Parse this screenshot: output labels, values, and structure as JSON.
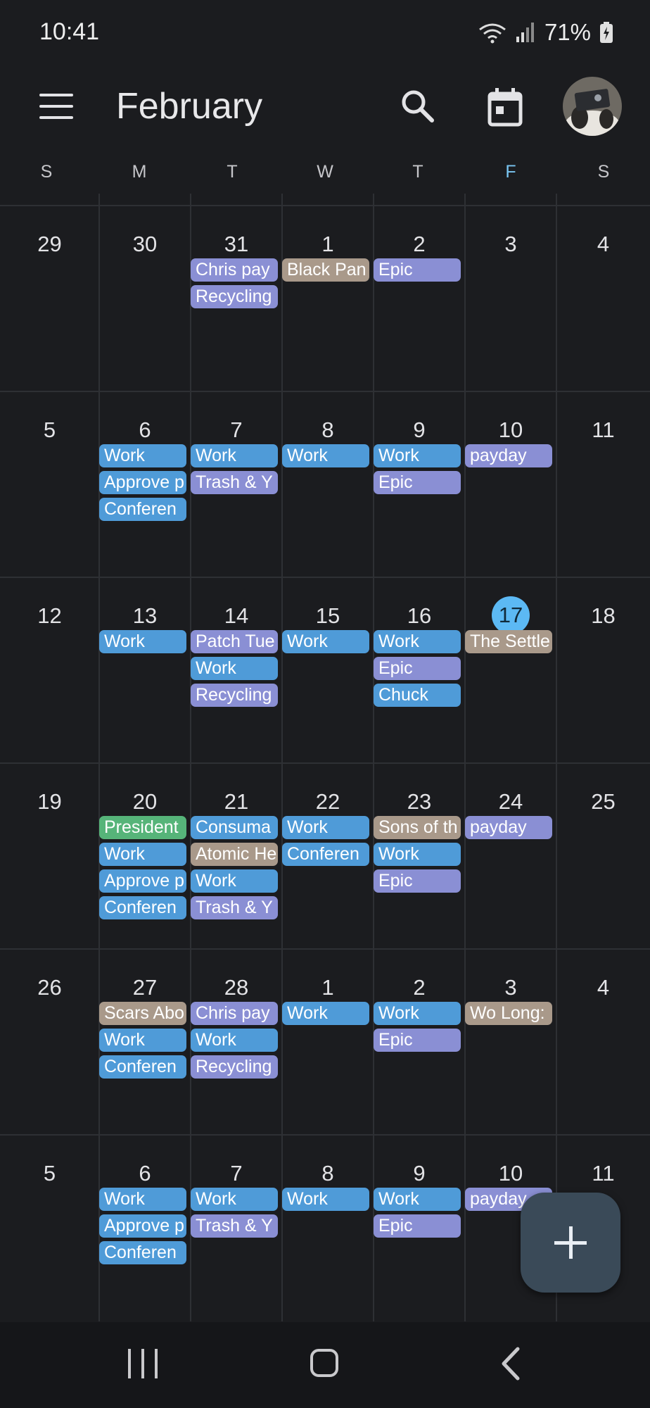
{
  "status": {
    "time": "10:41",
    "battery": "71%"
  },
  "header": {
    "title": "February"
  },
  "days_of_week": [
    {
      "label": "S",
      "hl": false
    },
    {
      "label": "M",
      "hl": false
    },
    {
      "label": "T",
      "hl": false
    },
    {
      "label": "W",
      "hl": false
    },
    {
      "label": "T",
      "hl": false
    },
    {
      "label": "F",
      "hl": true
    },
    {
      "label": "S",
      "hl": false
    }
  ],
  "colors": {
    "work_blue": "#4f9bd8",
    "task_purple": "#8a8fd4",
    "release_tan": "#a9998a",
    "holiday_green": "#56b479",
    "today": "#5cb9f4"
  },
  "weeks": [
    {
      "days": [
        {
          "num": "29",
          "events": []
        },
        {
          "num": "30",
          "events": []
        },
        {
          "num": "31",
          "events": [
            {
              "t": "Chris pay",
              "c": "purple"
            },
            {
              "t": "Recycling",
              "c": "purple"
            }
          ]
        },
        {
          "num": "1",
          "events": [
            {
              "t": "Black Pan",
              "c": "tan"
            }
          ]
        },
        {
          "num": "2",
          "events": [
            {
              "t": "Epic",
              "c": "purple"
            }
          ]
        },
        {
          "num": "3",
          "events": []
        },
        {
          "num": "4",
          "events": []
        }
      ]
    },
    {
      "days": [
        {
          "num": "5",
          "events": []
        },
        {
          "num": "6",
          "events": [
            {
              "t": "Work",
              "c": "blue"
            },
            {
              "t": "Approve p",
              "c": "blue"
            },
            {
              "t": "Conferen",
              "c": "blue"
            }
          ]
        },
        {
          "num": "7",
          "events": [
            {
              "t": "Work",
              "c": "blue"
            },
            {
              "t": "Trash & Y",
              "c": "purple"
            }
          ]
        },
        {
          "num": "8",
          "events": [
            {
              "t": "Work",
              "c": "blue"
            }
          ]
        },
        {
          "num": "9",
          "events": [
            {
              "t": "Work",
              "c": "blue"
            },
            {
              "t": "Epic",
              "c": "purple"
            }
          ]
        },
        {
          "num": "10",
          "events": [
            {
              "t": "payday",
              "c": "purple"
            }
          ]
        },
        {
          "num": "11",
          "events": []
        }
      ]
    },
    {
      "days": [
        {
          "num": "12",
          "events": []
        },
        {
          "num": "13",
          "events": [
            {
              "t": "Work",
              "c": "blue"
            }
          ]
        },
        {
          "num": "14",
          "events": [
            {
              "t": "Patch Tue",
              "c": "purple"
            },
            {
              "t": "Work",
              "c": "blue"
            },
            {
              "t": "Recycling",
              "c": "purple"
            }
          ]
        },
        {
          "num": "15",
          "events": [
            {
              "t": "Work",
              "c": "blue"
            }
          ]
        },
        {
          "num": "16",
          "events": [
            {
              "t": "Work",
              "c": "blue"
            },
            {
              "t": "Epic",
              "c": "purple"
            },
            {
              "t": "Chuck",
              "c": "blue"
            }
          ]
        },
        {
          "num": "17",
          "today": true,
          "events": [
            {
              "t": "The Settle",
              "c": "tan"
            }
          ]
        },
        {
          "num": "18",
          "events": []
        }
      ]
    },
    {
      "days": [
        {
          "num": "19",
          "events": []
        },
        {
          "num": "20",
          "events": [
            {
              "t": "President",
              "c": "green"
            },
            {
              "t": "Work",
              "c": "blue"
            },
            {
              "t": "Approve p",
              "c": "blue"
            },
            {
              "t": "Conferen",
              "c": "blue"
            }
          ]
        },
        {
          "num": "21",
          "events": [
            {
              "t": "Consuma",
              "c": "blue"
            },
            {
              "t": "Atomic He",
              "c": "tan"
            },
            {
              "t": "Work",
              "c": "blue"
            },
            {
              "t": "Trash & Y",
              "c": "purple"
            }
          ]
        },
        {
          "num": "22",
          "events": [
            {
              "t": "Work",
              "c": "blue"
            },
            {
              "t": "Conferen",
              "c": "blue"
            }
          ]
        },
        {
          "num": "23",
          "events": [
            {
              "t": "Sons of th",
              "c": "tan"
            },
            {
              "t": "Work",
              "c": "blue"
            },
            {
              "t": "Epic",
              "c": "purple"
            }
          ]
        },
        {
          "num": "24",
          "events": [
            {
              "t": "payday",
              "c": "purple"
            }
          ]
        },
        {
          "num": "25",
          "events": []
        }
      ]
    },
    {
      "days": [
        {
          "num": "26",
          "events": []
        },
        {
          "num": "27",
          "events": [
            {
              "t": "Scars Abo",
              "c": "tan"
            },
            {
              "t": "Work",
              "c": "blue"
            },
            {
              "t": "Conferen",
              "c": "blue"
            }
          ]
        },
        {
          "num": "28",
          "events": [
            {
              "t": "Chris pay",
              "c": "purple"
            },
            {
              "t": "Work",
              "c": "blue"
            },
            {
              "t": "Recycling",
              "c": "purple"
            }
          ]
        },
        {
          "num": "1",
          "events": [
            {
              "t": "Work",
              "c": "blue"
            }
          ]
        },
        {
          "num": "2",
          "events": [
            {
              "t": "Work",
              "c": "blue"
            },
            {
              "t": "Epic",
              "c": "purple"
            }
          ]
        },
        {
          "num": "3",
          "events": [
            {
              "t": "Wo Long:",
              "c": "tan"
            }
          ]
        },
        {
          "num": "4",
          "events": []
        }
      ]
    },
    {
      "days": [
        {
          "num": "5",
          "events": []
        },
        {
          "num": "6",
          "events": [
            {
              "t": "Work",
              "c": "blue"
            },
            {
              "t": "Approve p",
              "c": "blue"
            },
            {
              "t": "Conferen",
              "c": "blue"
            }
          ]
        },
        {
          "num": "7",
          "events": [
            {
              "t": "Work",
              "c": "blue"
            },
            {
              "t": "Trash & Y",
              "c": "purple"
            }
          ]
        },
        {
          "num": "8",
          "events": [
            {
              "t": "Work",
              "c": "blue"
            }
          ]
        },
        {
          "num": "9",
          "events": [
            {
              "t": "Work",
              "c": "blue"
            },
            {
              "t": "Epic",
              "c": "purple"
            }
          ]
        },
        {
          "num": "10",
          "events": [
            {
              "t": "payday",
              "c": "purple"
            }
          ]
        },
        {
          "num": "11",
          "events": []
        }
      ]
    }
  ],
  "icons": {
    "menu": "menu-icon",
    "search": "search-icon",
    "today": "calendar-today-icon",
    "fab": "plus-icon"
  }
}
